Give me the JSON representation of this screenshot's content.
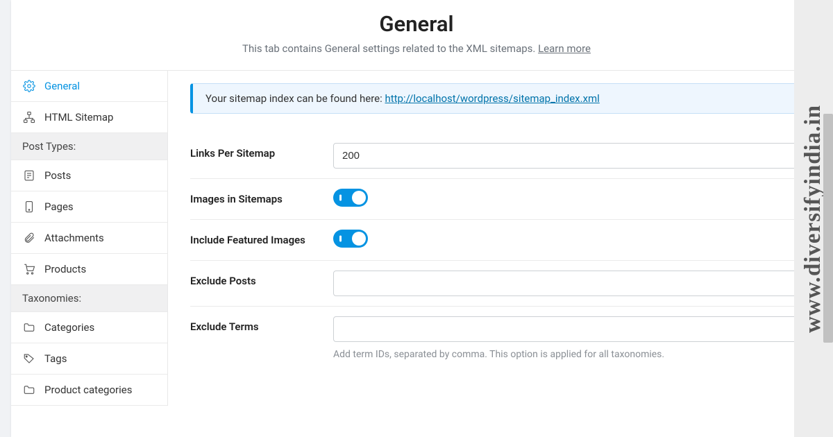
{
  "header": {
    "title": "General",
    "desc_prefix": "This tab contains General settings related to the XML sitemaps. ",
    "learn_more": "Learn more"
  },
  "sidebar": {
    "items": [
      {
        "label": "General",
        "icon": "gear",
        "active": true
      },
      {
        "label": "HTML Sitemap",
        "icon": "sitemap"
      }
    ],
    "group1_label": "Post Types:",
    "group1_items": [
      {
        "label": "Posts",
        "icon": "post"
      },
      {
        "label": "Pages",
        "icon": "page"
      },
      {
        "label": "Attachments",
        "icon": "clip"
      },
      {
        "label": "Products",
        "icon": "cart"
      }
    ],
    "group2_label": "Taxonomies:",
    "group2_items": [
      {
        "label": "Categories",
        "icon": "folder"
      },
      {
        "label": "Tags",
        "icon": "tag"
      },
      {
        "label": "Product categories",
        "icon": "folder"
      }
    ]
  },
  "notice": {
    "prefix": "Your sitemap index can be found here: ",
    "url": "http://localhost/wordpress/sitemap_index.xml"
  },
  "fields": {
    "links_per_sitemap": {
      "label": "Links Per Sitemap",
      "value": "200"
    },
    "images_in_sitemaps": {
      "label": "Images in Sitemaps",
      "value": true
    },
    "include_featured": {
      "label": "Include Featured Images",
      "value": true
    },
    "exclude_posts": {
      "label": "Exclude Posts",
      "value": ""
    },
    "exclude_terms": {
      "label": "Exclude Terms",
      "value": "",
      "help": "Add term IDs, separated by comma. This option is applied for all taxonomies."
    }
  },
  "watermark": "www.diversifyindia.in"
}
